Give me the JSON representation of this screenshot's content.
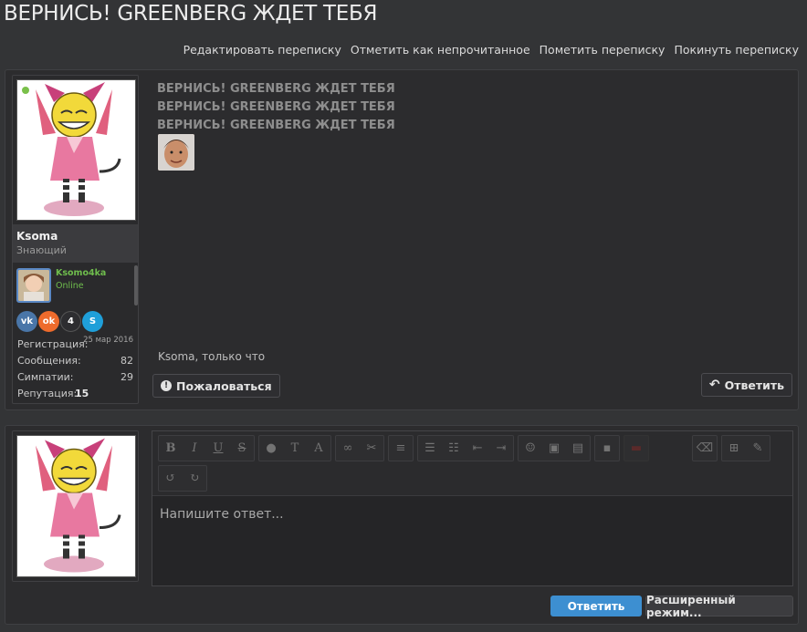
{
  "thread": {
    "title": "ВЕРНИСЬ! GREENBERG ЖДЕТ ТЕБЯ",
    "actions": [
      "Редактировать переписку",
      "Отметить как непрочитанное",
      "Пометить переписку",
      "Покинуть переписку"
    ]
  },
  "message": {
    "lines": [
      "ВЕРНИСЬ! GREENBERG ЖДЕТ ТЕБЯ",
      "ВЕРНИСЬ! GREENBERG ЖДЕТ ТЕБЯ",
      "ВЕРНИСЬ! GREENBERG ЖДЕТ ТЕБЯ"
    ],
    "meta": "Ksoma, только что",
    "report_label": "Пожаловаться",
    "reply_label": "Ответить"
  },
  "user": {
    "name": "Ksoma",
    "rank": "Знающий",
    "sub_name": "Ksomo4ka",
    "sub_status": "Online",
    "socials": [
      "vk-icon",
      "odnoklassniki-icon",
      "steam-icon",
      "skype-icon"
    ],
    "stats": [
      {
        "label": "Регистрация:",
        "value": "25 мар 2016"
      },
      {
        "label": "Сообщения:",
        "value": "82"
      },
      {
        "label": "Симпатии:",
        "value": "29"
      },
      {
        "label": "Репутация:",
        "value": "15"
      }
    ]
  },
  "editor": {
    "placeholder": "Напишите ответ...",
    "submit_label": "Ответить",
    "advanced_label": "Расширенный режим..."
  },
  "colors": {
    "accent": "#3d8fd1",
    "online": "#6fbd4d",
    "background": "#333436"
  }
}
